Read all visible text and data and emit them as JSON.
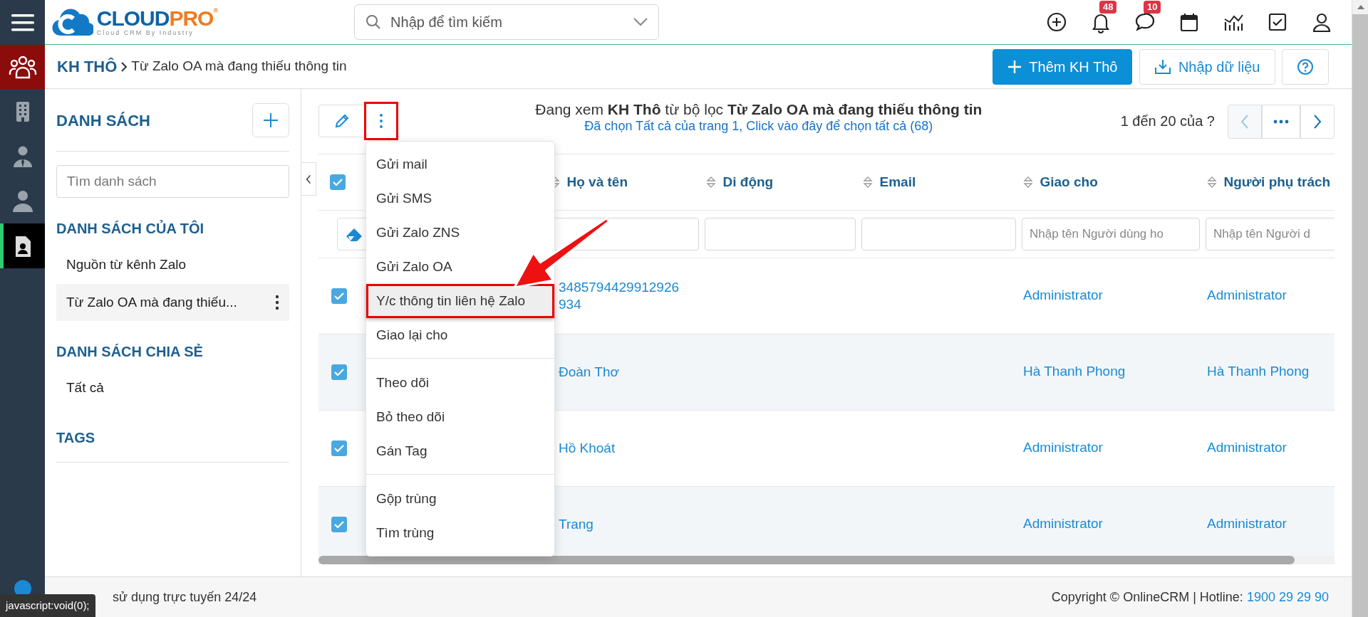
{
  "logo": {
    "primary": "CLOUD",
    "accent": "PRO",
    "registered": "®",
    "tagline": "Cloud CRM By Industry"
  },
  "search": {
    "placeholder": "Nhập để tìm kiếm"
  },
  "top_bar": {
    "notification_count": "48",
    "message_count": "10"
  },
  "rail": {
    "items": [
      {
        "selected": false
      },
      {
        "selected": false
      },
      {
        "selected": false
      },
      {
        "selected": true
      }
    ]
  },
  "breadcrumb": {
    "module": "KH THÔ",
    "current": "Từ Zalo OA mà đang thiếu thông tin"
  },
  "actions": [
    {
      "kind": "primary",
      "label": "Thêm KH Thô"
    },
    {
      "kind": "import",
      "label": "Nhập dữ liệu"
    },
    {
      "kind": "help"
    }
  ],
  "sidebar": {
    "title": "DANH SÁCH",
    "search": {
      "placeholder": "Tìm danh sách"
    },
    "sections": [
      {
        "title": "DANH SÁCH CỦA TÔI",
        "items": [
          {
            "label": "Nguồn từ kênh Zalo",
            "selected": false
          },
          {
            "label": "Từ Zalo OA mà đang thiếu...",
            "selected": true
          }
        ]
      },
      {
        "title": "DANH SÁCH CHIA SẺ",
        "items": [
          {
            "label": "Tất cả",
            "selected": false
          }
        ]
      },
      {
        "title": "TAGS"
      }
    ]
  },
  "toolbar": {
    "more_button": {
      "annotated": true
    }
  },
  "view_header": {
    "title": "Đang xem **KH Thô** từ bộ lọc **Từ Zalo OA mà đang thiếu thông tin**",
    "selection_link": "Đã chọn Tất cả của trang 1, Click vào đây để chọn tất cả (68)"
  },
  "pagination": {
    "range": "1 đến 20 của",
    "total": "?"
  },
  "table": {
    "all_selected": true,
    "columns": [
      {
        "label": "Họ và tên"
      },
      {
        "label": "Di động"
      },
      {
        "label": "Email"
      },
      {
        "label": "Giao cho",
        "filter_placeholder": "Nhập tên Người dùng ho"
      },
      {
        "label": "Người phụ trách",
        "filter_placeholder": "Nhập tên Người d"
      }
    ],
    "rows": [
      {
        "selected": true,
        "name_lines": [
          "3485794429912926",
          "934"
        ],
        "assigned_to": "Administrator",
        "owner": "Administrator"
      },
      {
        "selected": true,
        "name_lines": [
          "Đoàn Thơ"
        ],
        "assigned_to": "Hà Thanh Phong",
        "owner": "Hà Thanh Phong"
      },
      {
        "selected": true,
        "name_lines": [
          "Hồ Khoát"
        ],
        "assigned_to": "Administrator",
        "owner": "Administrator"
      },
      {
        "selected": true,
        "name_lines": [
          "Trang"
        ],
        "assigned_to": "Administrator",
        "owner": "Administrator"
      }
    ]
  },
  "menu": {
    "groups": [
      [
        {
          "label": "Gửi mail",
          "annotated": false
        },
        {
          "label": "Gửi SMS",
          "annotated": false
        },
        {
          "label": "Gửi Zalo ZNS",
          "annotated": false
        },
        {
          "label": "Gửi Zalo OA",
          "annotated": false
        },
        {
          "label": "Y/c thông tin liên hệ Zalo",
          "annotated": true
        },
        {
          "label": "Giao lại cho",
          "annotated": false
        }
      ],
      [
        {
          "label": "Theo dõi",
          "annotated": false
        },
        {
          "label": "Bỏ theo dõi",
          "annotated": false
        },
        {
          "label": "Gán Tag",
          "annotated": false
        }
      ],
      [
        {
          "label": "Gộp trùng",
          "annotated": false
        },
        {
          "label": "Tìm trùng",
          "annotated": false
        }
      ]
    ]
  },
  "footer": {
    "left": "sử dụng trực tuyến 24/24",
    "copyright": "Copyright © OnlineCRM",
    "separator": "|",
    "hotline_label": "Hotline:",
    "hotline": "1900 29 29 90"
  },
  "status_tooltip": "javascript:void(0);"
}
